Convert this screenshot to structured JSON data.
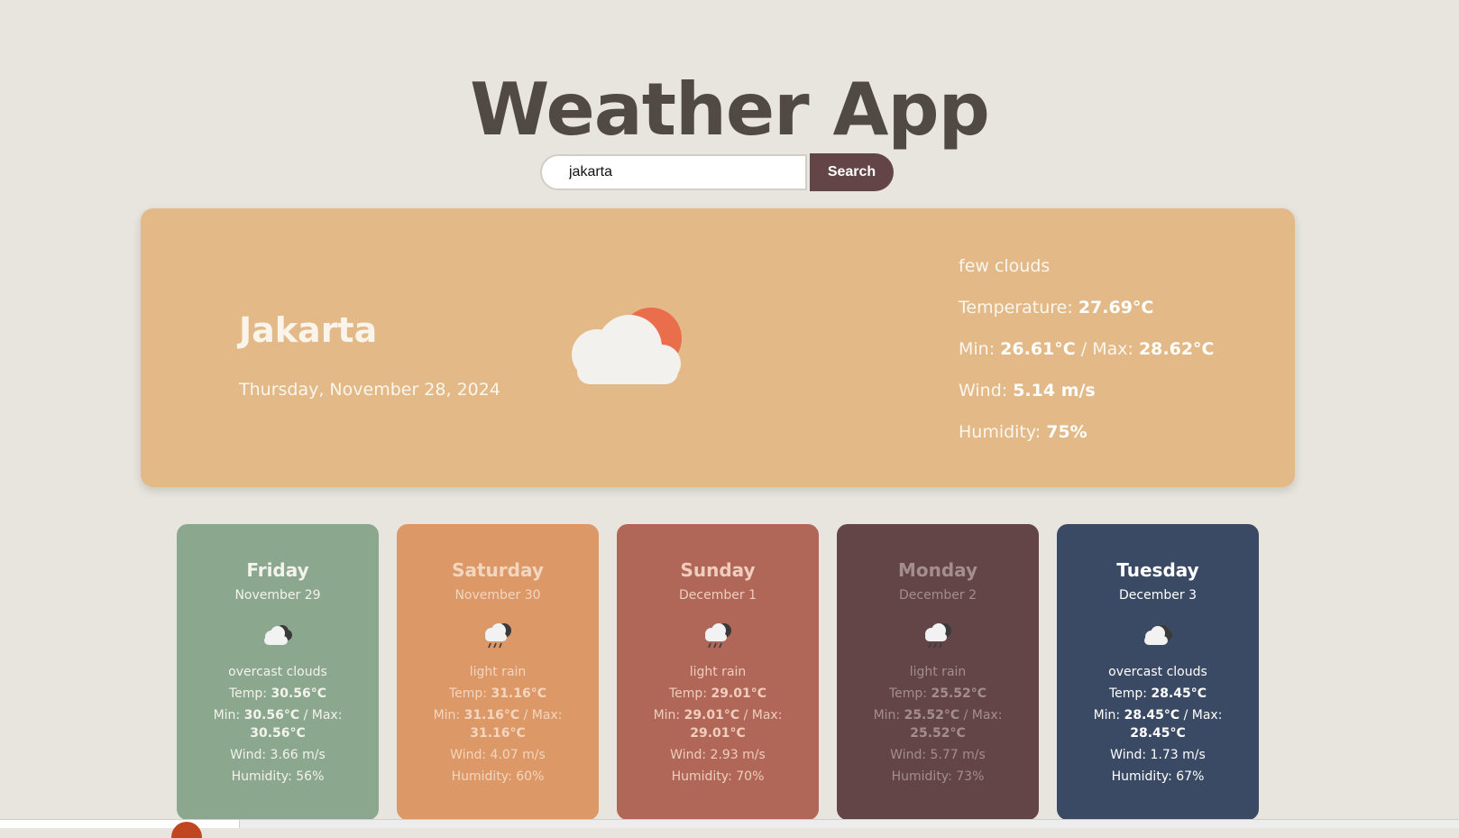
{
  "app": {
    "title": "Weather App"
  },
  "search": {
    "value": "jakarta",
    "button_label": "Search"
  },
  "current": {
    "city": "Jakarta",
    "date": "Thursday, November 28, 2024",
    "description": "few clouds",
    "temperature_label": "Temperature:",
    "temperature": "27.69°C",
    "min_label": "Min:",
    "min": "26.61°C",
    "max_label": "/ Max:",
    "max": "28.62°C",
    "wind_label": "Wind:",
    "wind": "5.14 m/s",
    "humidity_label": "Humidity:",
    "humidity": "75%",
    "icon": "few-clouds-icon"
  },
  "forecast": [
    {
      "day": "Friday",
      "date": "November 29",
      "icon": "overcast-clouds-icon",
      "description": "overcast clouds",
      "temp_label": "Temp:",
      "temp": "30.56°C",
      "min_label": "Min:",
      "min": "30.56°C",
      "max_label": "/ Max:",
      "max": "30.56°C",
      "wind_label": "Wind:",
      "wind": "3.66 m/s",
      "humidity_label": "Humidity:",
      "humidity": "56%",
      "bg": "#8ba88f",
      "color": "#f4f2ec"
    },
    {
      "day": "Saturday",
      "date": "November 30",
      "icon": "light-rain-icon",
      "description": "light rain",
      "temp_label": "Temp:",
      "temp": "31.16°C",
      "min_label": "Min:",
      "min": "31.16°C",
      "max_label": "/ Max:",
      "max": "31.16°C",
      "wind_label": "Wind:",
      "wind": "4.07 m/s",
      "humidity_label": "Humidity:",
      "humidity": "60%",
      "bg": "#dd9867",
      "color": "#f3d6bf"
    },
    {
      "day": "Sunday",
      "date": "December 1",
      "icon": "light-rain-icon",
      "description": "light rain",
      "temp_label": "Temp:",
      "temp": "29.01°C",
      "min_label": "Min:",
      "min": "29.01°C",
      "max_label": "/ Max:",
      "max": "29.01°C",
      "wind_label": "Wind:",
      "wind": "2.93 m/s",
      "humidity_label": "Humidity:",
      "humidity": "70%",
      "bg": "#b06757",
      "color": "#f0cdbf"
    },
    {
      "day": "Monday",
      "date": "December 2",
      "icon": "light-rain-icon",
      "description": "light rain",
      "temp_label": "Temp:",
      "temp": "25.52°C",
      "min_label": "Min:",
      "min": "25.52°C",
      "max_label": "/ Max:",
      "max": "25.52°C",
      "wind_label": "Wind:",
      "wind": "5.77 m/s",
      "humidity_label": "Humidity:",
      "humidity": "73%",
      "bg": "#634548",
      "color": "#a48e8c"
    },
    {
      "day": "Tuesday",
      "date": "December 3",
      "icon": "overcast-clouds-icon",
      "description": "overcast clouds",
      "temp_label": "Temp:",
      "temp": "28.45°C",
      "min_label": "Min:",
      "min": "28.45°C",
      "max_label": "/ Max:",
      "max": "28.45°C",
      "wind_label": "Wind:",
      "wind": "1.73 m/s",
      "humidity_label": "Humidity:",
      "humidity": "67%",
      "bg": "#3b4a64",
      "color": "#ffffff"
    }
  ],
  "colors": {
    "background": "#e8e4de",
    "title": "#514a44",
    "current_card": "#e2b987",
    "search_button": "#634548"
  }
}
